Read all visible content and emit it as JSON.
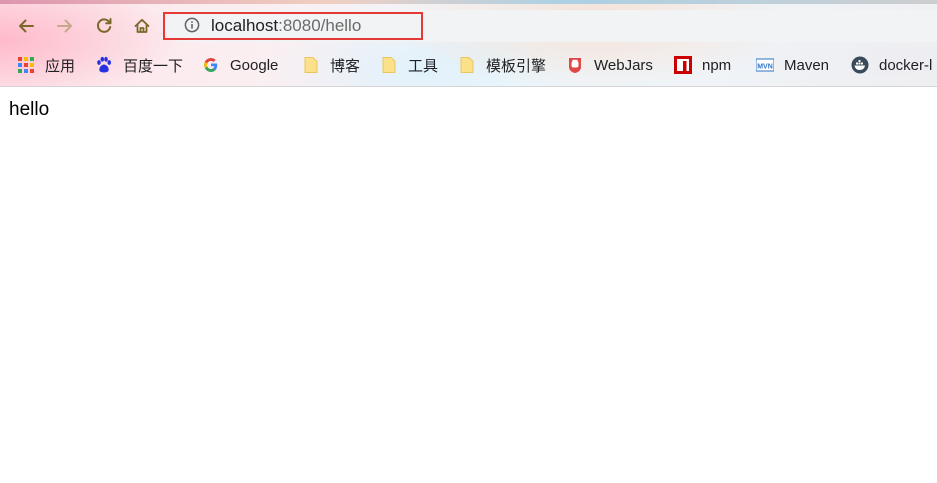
{
  "browser": {
    "url_host": "localhost",
    "url_rest": ":8080/hello",
    "buttons": {
      "back_icon": "arrow-left-icon",
      "forward_icon": "arrow-right-icon",
      "reload_icon": "reload-icon",
      "home_icon": "home-icon"
    },
    "security_icon": "info-icon",
    "highlight_color": "#e53935"
  },
  "bookmarks": [
    {
      "label": "应用",
      "icon": "apps-grid-icon"
    },
    {
      "label": "百度一下",
      "icon": "baidu-paw-icon"
    },
    {
      "label": "Google",
      "icon": "google-g-icon"
    },
    {
      "label": "博客",
      "icon": "folder-icon"
    },
    {
      "label": "工具",
      "icon": "folder-icon"
    },
    {
      "label": "模板引擎",
      "icon": "folder-icon"
    },
    {
      "label": "WebJars",
      "icon": "webjars-icon"
    },
    {
      "label": "npm",
      "icon": "npm-icon"
    },
    {
      "label": "Maven",
      "icon": "maven-icon"
    },
    {
      "label": "docker-l",
      "icon": "docker-icon"
    }
  ],
  "page": {
    "body_text": "hello"
  }
}
